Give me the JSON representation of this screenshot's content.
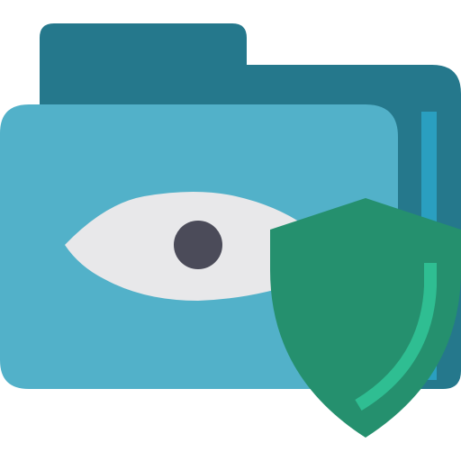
{
  "icon": {
    "name": "private-folder-icon",
    "parts": [
      "folder-icon",
      "eye-icon",
      "shield-icon"
    ]
  },
  "colors": {
    "background": "#ffffff",
    "folder_back": "#25788c",
    "folder_front": "#52b1c9",
    "folder_stripe": "#2a9fc0",
    "eye_white": "#e8e8ea",
    "pupil": "#4b4b59",
    "shield": "#25906e",
    "shield_highlight": "#2fbe92"
  }
}
